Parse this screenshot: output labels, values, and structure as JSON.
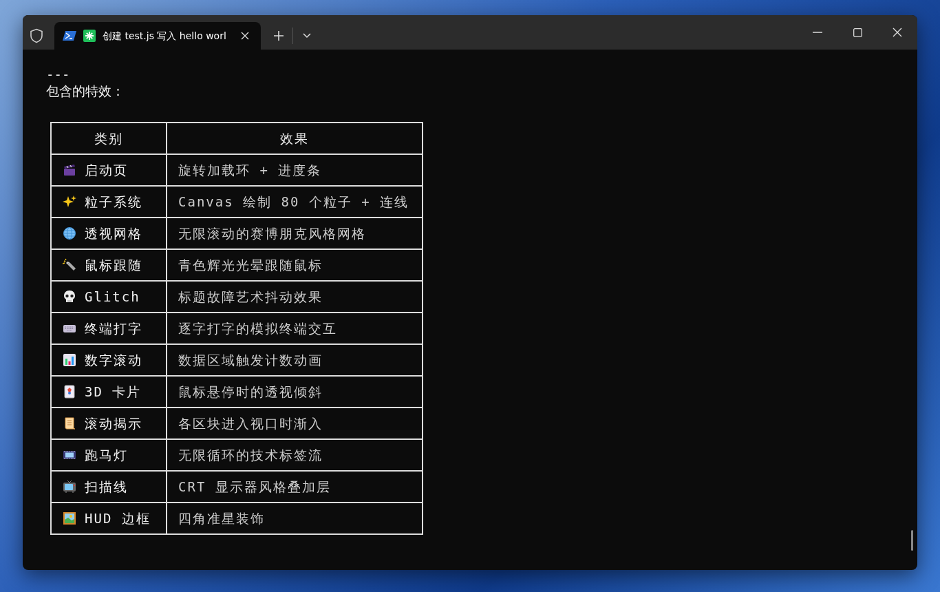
{
  "window": {
    "tab": {
      "title": "创建 test.js 写入 hello worl",
      "selected": true
    }
  },
  "terminal": {
    "lines": [
      "---",
      "包含的特效："
    ],
    "table": {
      "columns": [
        "类别",
        "效果"
      ],
      "rows": [
        {
          "kind": "clapper",
          "category": "启动页",
          "effect": "旋转加载环 + 进度条"
        },
        {
          "kind": "sparkles",
          "category": "粒子系统",
          "effect": "Canvas 绘制 80 个粒子 + 连线"
        },
        {
          "kind": "globe",
          "category": "透视网格",
          "effect": "无限滚动的赛博朋克风格网格"
        },
        {
          "kind": "flashlight",
          "category": "鼠标跟随",
          "effect": "青色辉光光晕跟随鼠标"
        },
        {
          "kind": "skull",
          "category": "Glitch",
          "effect": "标题故障艺术抖动效果"
        },
        {
          "kind": "keyboard",
          "category": "终端打字",
          "effect": "逐字打字的模拟终端交互"
        },
        {
          "kind": "chart",
          "category": "数字滚动",
          "effect": "数据区域触发计数动画"
        },
        {
          "kind": "card",
          "category": "3D 卡片",
          "effect": "鼠标悬停时的透视倾斜"
        },
        {
          "kind": "scroll",
          "category": "滚动揭示",
          "effect": "各区块进入视口时渐入"
        },
        {
          "kind": "film",
          "category": "跑马灯",
          "effect": "无限循环的技术标签流"
        },
        {
          "kind": "tv",
          "category": "扫描线",
          "effect": "CRT 显示器风格叠加层"
        },
        {
          "kind": "picture",
          "category": "HUD 边框",
          "effect": "四角准星装饰"
        }
      ]
    }
  }
}
